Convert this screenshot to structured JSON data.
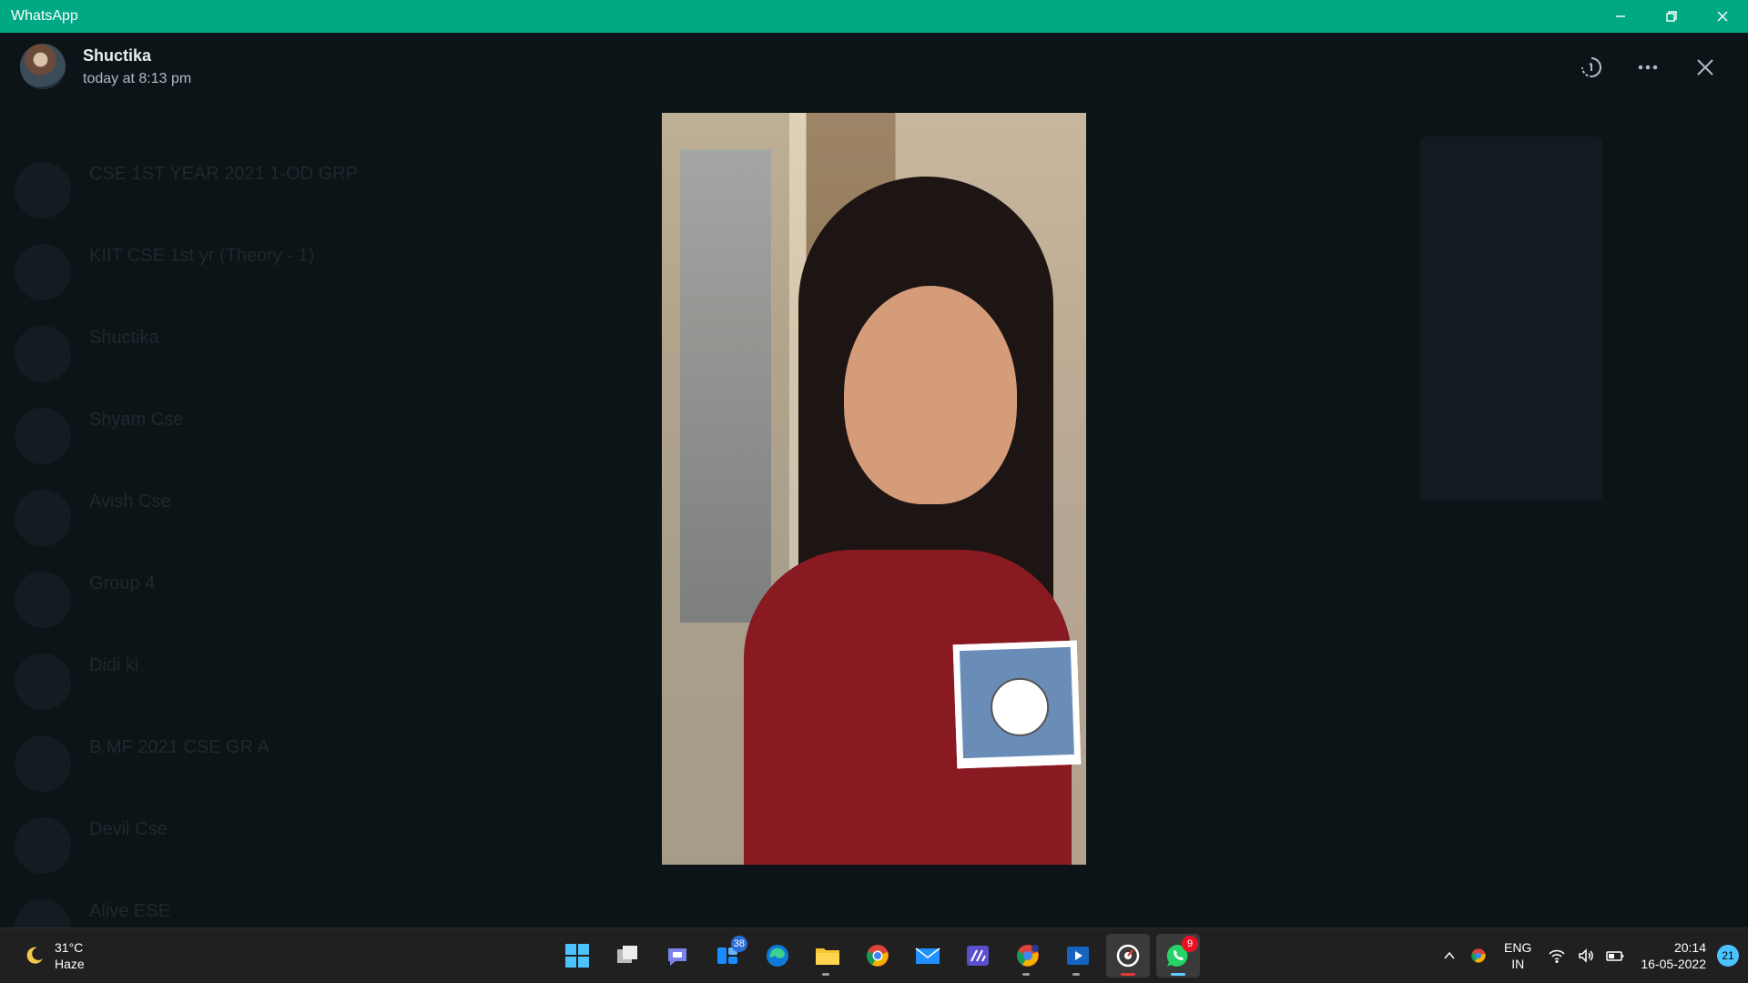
{
  "window": {
    "title": "WhatsApp"
  },
  "viewer": {
    "sender_name": "Shuctika",
    "sent_time": "today at 8:13 pm"
  },
  "background_chats": [
    {
      "name": "CSE 1ST YEAR 2021 1-OD GRP",
      "preview": ""
    },
    {
      "name": "KIIT CSE 1st yr (Theory - 1)",
      "preview": ""
    },
    {
      "name": "Shuctika",
      "preview": ""
    },
    {
      "name": "Shyam Cse",
      "preview": ""
    },
    {
      "name": "Avish Cse",
      "preview": ""
    },
    {
      "name": "Group 4",
      "preview": ""
    },
    {
      "name": "Didi ki",
      "preview": ""
    },
    {
      "name": "B.MF 2021 CSE GR A",
      "preview": ""
    },
    {
      "name": "Devil Cse",
      "preview": ""
    },
    {
      "name": "Alive ESE",
      "preview": ""
    }
  ],
  "taskbar": {
    "weather": {
      "temp": "31°C",
      "condition": "Haze"
    },
    "apps": [
      {
        "name": "start",
        "icon": "windows-start-icon"
      },
      {
        "name": "task-view",
        "icon": "task-view-icon"
      },
      {
        "name": "chat",
        "icon": "teams-chat-icon"
      },
      {
        "name": "widgets",
        "icon": "widgets-icon",
        "badge": "38"
      },
      {
        "name": "edge",
        "icon": "edge-icon"
      },
      {
        "name": "file-explorer",
        "icon": "folder-icon"
      },
      {
        "name": "chrome",
        "icon": "chrome-icon"
      },
      {
        "name": "mail",
        "icon": "mail-icon"
      },
      {
        "name": "editor",
        "icon": "pen-app-icon"
      },
      {
        "name": "chrome-profile",
        "icon": "chrome-profile-icon"
      },
      {
        "name": "media-player",
        "icon": "media-player-icon"
      },
      {
        "name": "screen-recorder",
        "icon": "record-icon"
      },
      {
        "name": "whatsapp",
        "icon": "whatsapp-icon",
        "badge": "9"
      }
    ],
    "tray": {
      "language": "ENG",
      "region": "IN",
      "time": "20:14",
      "date": "16-05-2022",
      "notifications": "21"
    }
  },
  "colors": {
    "titlebar": "#00a884",
    "background": "#0d1418",
    "taskbar": "#202020",
    "badge_red": "#e81123",
    "badge_blue": "#2b6cd6"
  }
}
